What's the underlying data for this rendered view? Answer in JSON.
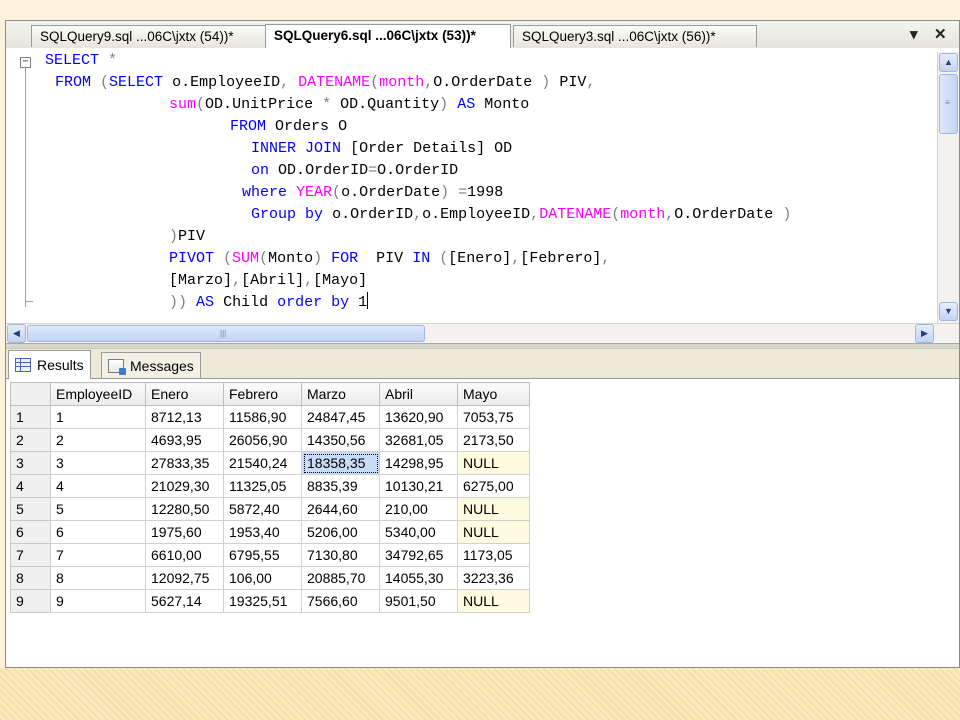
{
  "tabs": [
    {
      "label": "SQLQuery9.sql ...06C\\jxtx (54))*",
      "active": false
    },
    {
      "label": "SQLQuery6.sql ...06C\\jxtx (53))*",
      "active": true
    },
    {
      "label": "SQLQuery3.sql ...06C\\jxtx (56))*",
      "active": false
    }
  ],
  "tab_controls": {
    "dropdown": "▾",
    "close": "✕"
  },
  "editor": {
    "collapse_glyph": "−",
    "query_lines": [
      "SELECT *",
      "FROM (SELECT o.EmployeeID, DATENAME(month,O.OrderDate ) PIV,",
      "sum(OD.UnitPrice * OD.Quantity) AS Monto",
      "FROM Orders O",
      "INNER JOIN [Order Details] OD",
      "on OD.OrderID=O.OrderID",
      "where YEAR(o.OrderDate) =1998",
      "Group by o.OrderID,o.EmployeeID,DATENAME(month,O.OrderDate )",
      ")PIV",
      "PIVOT (SUM(Monto) FOR  PIV IN ([Enero],[Febrero],",
      "[Marzo],[Abril],[Mayo]",
      ")) AS Child order by 1"
    ]
  },
  "results_tabs": [
    {
      "label": "Results",
      "icon": "results-grid-icon",
      "active": true
    },
    {
      "label": "Messages",
      "icon": "messages-icon",
      "active": false
    }
  ],
  "grid": {
    "columns": [
      "EmployeeID",
      "Enero",
      "Febrero",
      "Marzo",
      "Abril",
      "Mayo"
    ],
    "rows": [
      [
        "1",
        "1",
        "8712,13",
        "11586,90",
        "24847,45",
        "13620,90",
        "7053,75"
      ],
      [
        "2",
        "2",
        "4693,95",
        "26056,90",
        "14350,56",
        "32681,05",
        "2173,50"
      ],
      [
        "3",
        "3",
        "27833,35",
        "21540,24",
        "18358,35",
        "14298,95",
        "NULL"
      ],
      [
        "4",
        "4",
        "21029,30",
        "11325,05",
        "8835,39",
        "10130,21",
        "6275,00"
      ],
      [
        "5",
        "5",
        "12280,50",
        "5872,40",
        "2644,60",
        "210,00",
        "NULL"
      ],
      [
        "6",
        "6",
        "1975,60",
        "1953,40",
        "5206,00",
        "5340,00",
        "NULL"
      ],
      [
        "7",
        "7",
        "6610,00",
        "6795,55",
        "7130,80",
        "34792,65",
        "1173,05"
      ],
      [
        "8",
        "8",
        "12092,75",
        "106,00",
        "20885,70",
        "14055,30",
        "3223,36"
      ],
      [
        "9",
        "9",
        "5627,14",
        "19325,51",
        "7566,60",
        "9501,50",
        "NULL"
      ]
    ],
    "selected_cell": {
      "row": 3,
      "column": "Marzo"
    }
  },
  "colors": {
    "keyword": "#0000ff",
    "function": "#ff00ff",
    "operator": "#808080",
    "null_cell": "#fffbe0",
    "selected_cell": "#c8dcf8"
  }
}
